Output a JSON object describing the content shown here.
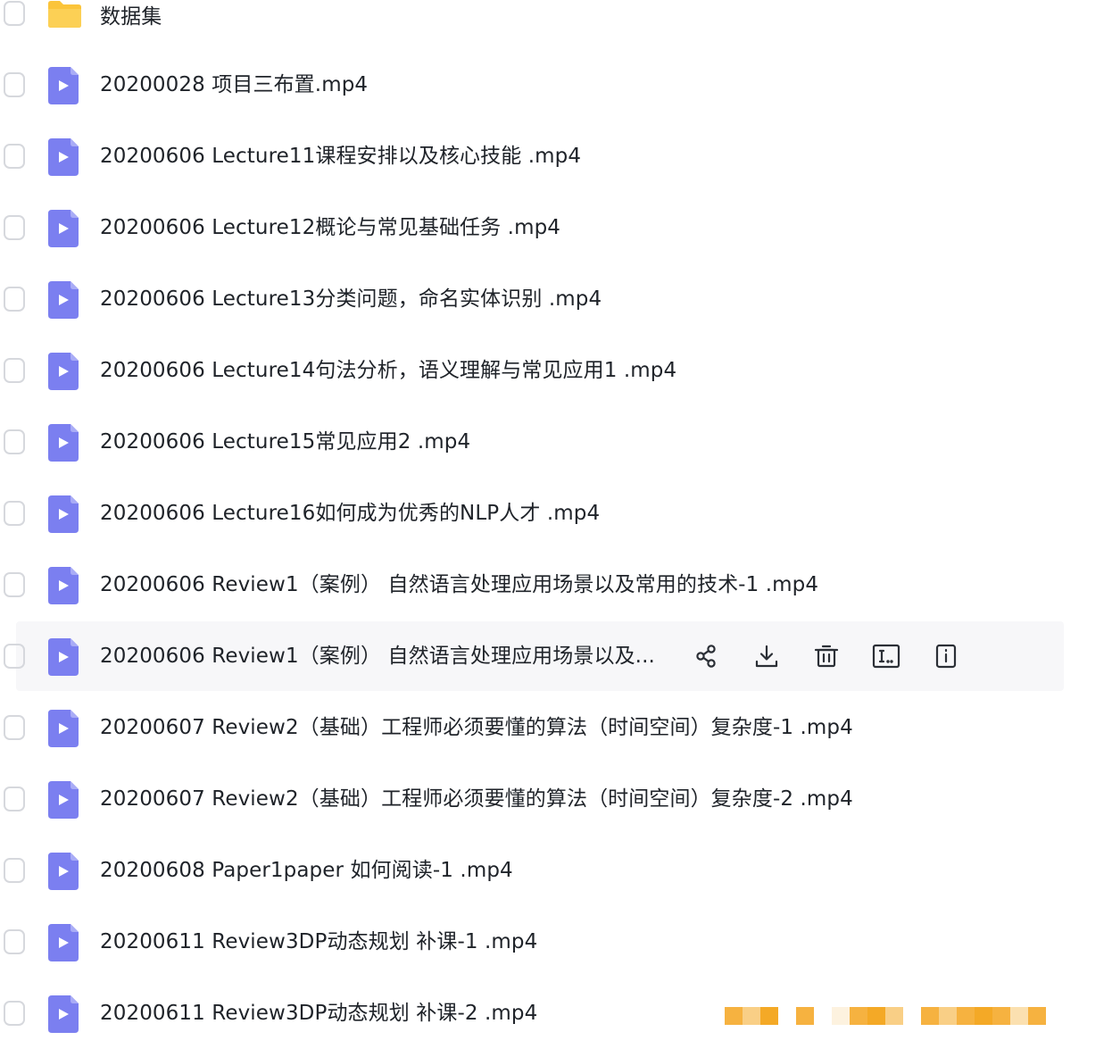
{
  "folder": {
    "name": "数据集",
    "icon": "folder-icon",
    "icon_color": "#fbc43a"
  },
  "files": [
    {
      "name": "20200028 项目三布置.mp4"
    },
    {
      "name": "20200606 Lecture11课程安排以及核心技能 .mp4"
    },
    {
      "name": "20200606 Lecture12概论与常见基础任务 .mp4"
    },
    {
      "name": "20200606 Lecture13分类问题，命名实体识别 .mp4"
    },
    {
      "name": "20200606 Lecture14句法分析，语义理解与常见应用1 .mp4"
    },
    {
      "name": "20200606 Lecture15常见应用2 .mp4"
    },
    {
      "name": "20200606 Lecture16如何成为优秀的NLP人才 .mp4"
    },
    {
      "name": "20200606 Review1（案例） 自然语言处理应用场景以及常用的技术-1 .mp4"
    },
    {
      "name": "20200606 Review1（案例） 自然语言处理应用场景以及..."
    },
    {
      "name": "20200607 Review2（基础）工程师必须要懂的算法（时间空间）复杂度-1 .mp4"
    },
    {
      "name": "20200607 Review2（基础）工程师必须要懂的算法（时间空间）复杂度-2 .mp4"
    },
    {
      "name": "20200608 Paper1paper 如何阅读-1 .mp4"
    },
    {
      "name": "20200611 Review3DP动态规划 补课-1 .mp4"
    },
    {
      "name": "20200611 Review3DP动态规划 补课-2 .mp4"
    }
  ],
  "file_icon": "video-file-icon",
  "file_icon_color": "#7b7ff0",
  "hover_actions": [
    {
      "icon": "share-icon"
    },
    {
      "icon": "download-icon"
    },
    {
      "icon": "delete-icon"
    },
    {
      "icon": "rename-icon"
    },
    {
      "icon": "details-icon"
    }
  ],
  "hover_background": "#f7f7f9",
  "action_color": "#2b2f36",
  "watermark_color": "#f6b240"
}
